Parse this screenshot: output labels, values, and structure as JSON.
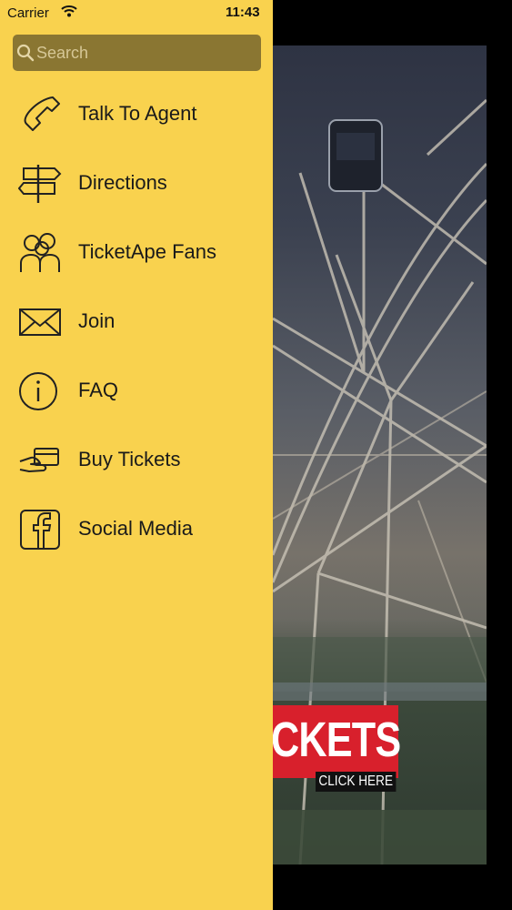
{
  "status_bar": {
    "carrier": "Carrier",
    "time": "11:43"
  },
  "search": {
    "placeholder": "Search",
    "value": ""
  },
  "menu": {
    "items": [
      {
        "label": "Talk To Agent",
        "icon": "phone-icon"
      },
      {
        "label": "Directions",
        "icon": "signpost-icon"
      },
      {
        "label": "TicketApe Fans",
        "icon": "users-icon"
      },
      {
        "label": "Join",
        "icon": "envelope-icon"
      },
      {
        "label": "FAQ",
        "icon": "info-icon"
      },
      {
        "label": "Buy Tickets",
        "icon": "card-payment-icon"
      },
      {
        "label": "Social Media",
        "icon": "facebook-icon"
      }
    ]
  },
  "background": {
    "banner_text": "CKETS",
    "banner_cta": "CLICK HERE"
  },
  "colors": {
    "drawer": "#f9d24e",
    "search_field": "#8a7632",
    "banner": "#d8202c"
  }
}
